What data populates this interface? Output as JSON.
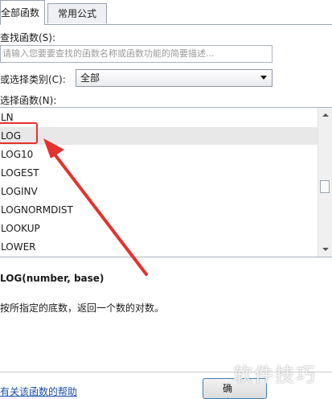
{
  "tabs": [
    "全部函数",
    "常用公式"
  ],
  "search": {
    "label": "查找函数(S):",
    "placeholder": "请输入您要要查找的函数名称或函数功能的简要描述..."
  },
  "category": {
    "label": "或选择类别(C):",
    "value": "全部"
  },
  "list": {
    "label": "选择函数(N):",
    "items": [
      "LN",
      "LOG",
      "LOG10",
      "LOGEST",
      "LOGINV",
      "LOGNORMDIST",
      "LOOKUP",
      "LOWER"
    ],
    "selected_index": 1
  },
  "detail": {
    "signature": "LOG(number, base)",
    "description": "按所指定的底数，返回一个数的对数。"
  },
  "footer": {
    "help_link": "有关该函数的帮助",
    "ok_button": "确"
  },
  "watermark": "软件技巧",
  "colors": {
    "annotation": "#e5322d",
    "link": "#1a4ea8",
    "selected_row": "#e8e8e8"
  }
}
